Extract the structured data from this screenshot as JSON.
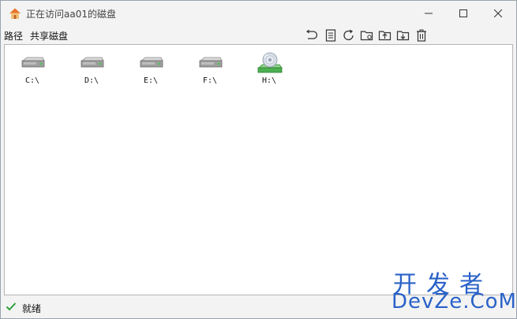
{
  "window": {
    "title": "正在访问aa01的磁盘"
  },
  "menu": {
    "path": "路径",
    "share": "共享磁盘"
  },
  "toolbar": [
    {
      "name": "undo-icon"
    },
    {
      "name": "document-icon"
    },
    {
      "name": "refresh-icon"
    },
    {
      "name": "folder-settings-icon"
    },
    {
      "name": "folder-upload-icon"
    },
    {
      "name": "folder-download-icon"
    },
    {
      "name": "trash-icon"
    }
  ],
  "drives": [
    {
      "label": "C:\\",
      "icon": "hard-drive-icon"
    },
    {
      "label": "D:\\",
      "icon": "hard-drive-icon"
    },
    {
      "label": "E:\\",
      "icon": "hard-drive-icon"
    },
    {
      "label": "F:\\",
      "icon": "hard-drive-icon"
    },
    {
      "label": "H:\\",
      "icon": "cd-drive-icon"
    }
  ],
  "status": {
    "text": "就绪"
  },
  "watermark": {
    "cn": "开发者",
    "en": "DevZe.CoM"
  },
  "colors": {
    "watermark": "#2a62c8",
    "status_check": "#2e9e3a",
    "cd_green": "#4caf50"
  }
}
